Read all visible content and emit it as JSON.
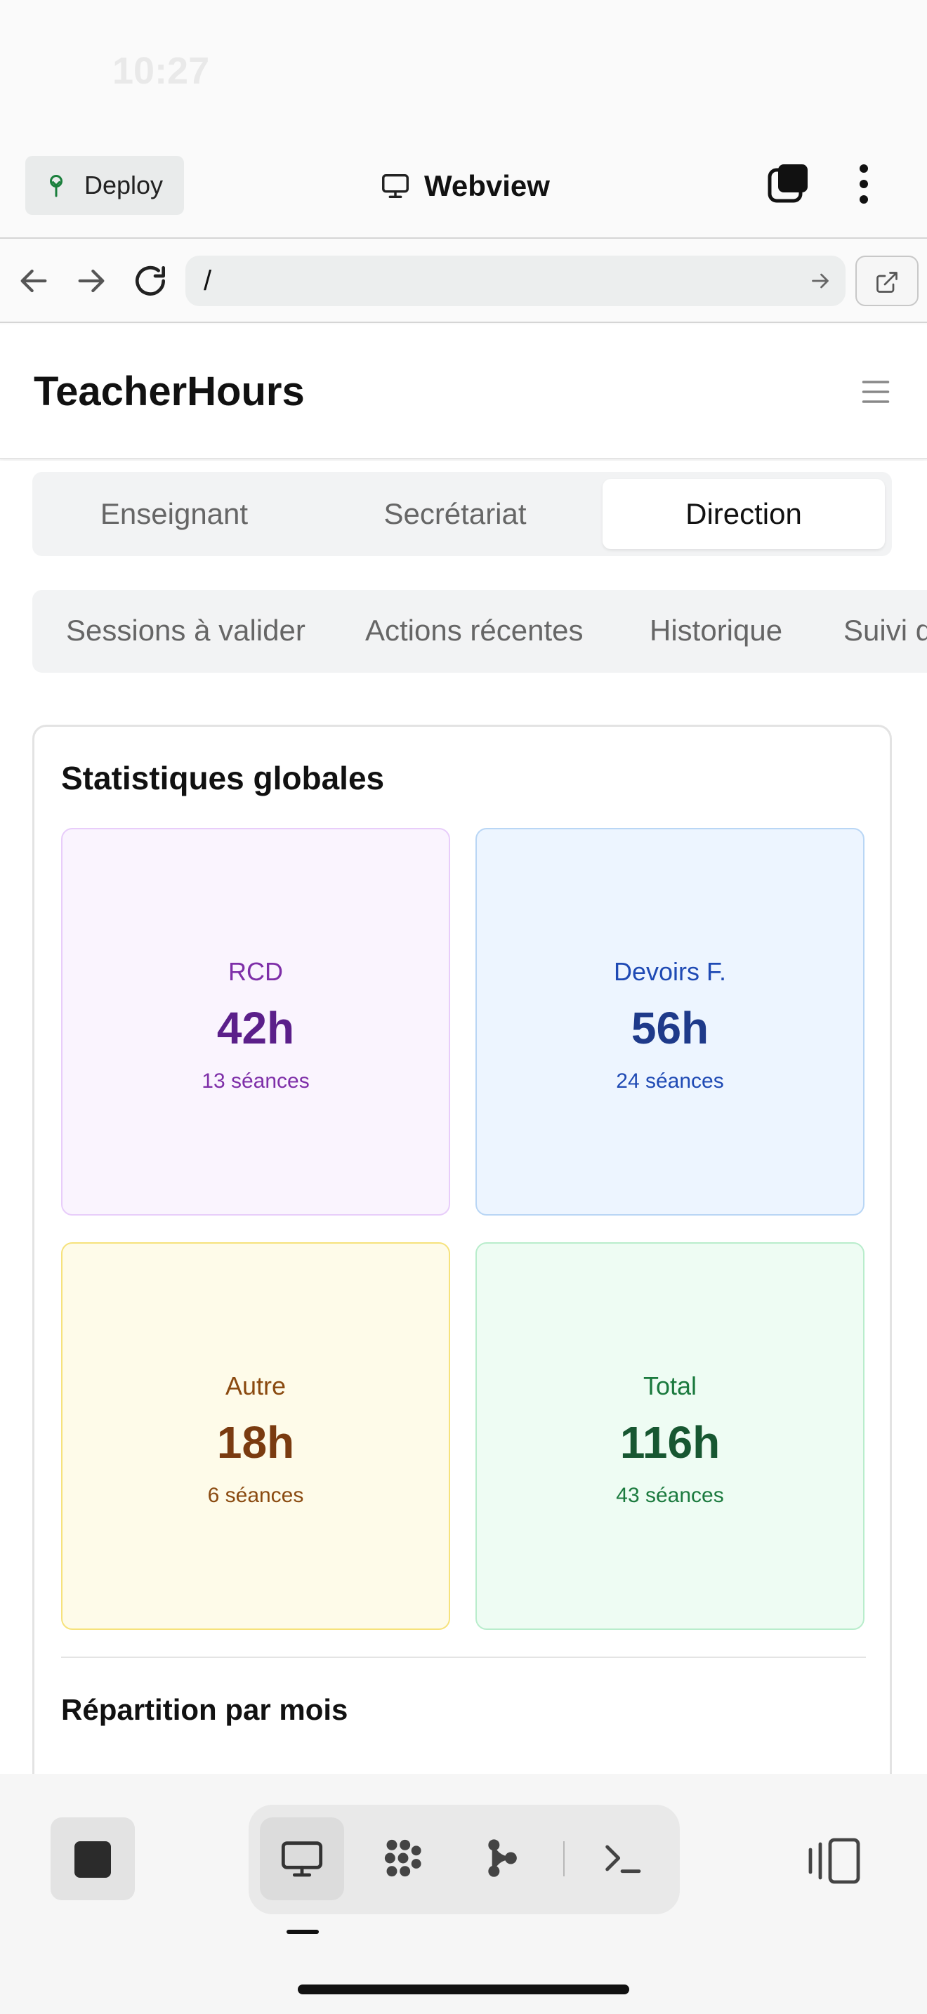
{
  "status_bar": {
    "time": "10:27"
  },
  "topbar": {
    "deploy_label": "Deploy",
    "webview_title": "Webview"
  },
  "urlbar": {
    "url": "/"
  },
  "app": {
    "title": "TeacherHours",
    "role_tabs": [
      "Enseignant",
      "Secrétariat",
      "Direction"
    ],
    "active_role": "Direction",
    "sub_tabs": [
      "Sessions à valider",
      "Actions récentes",
      "Historique",
      "Suivi d"
    ],
    "stats": {
      "title": "Statistiques globales",
      "boxes": [
        {
          "label": "RCD",
          "value": "42h",
          "count": "13 séances",
          "color": "#5b1f8a"
        },
        {
          "label": "Devoirs F.",
          "value": "56h",
          "count": "24 séances",
          "color": "#1e3a8a"
        },
        {
          "label": "Autre",
          "value": "18h",
          "count": "6 séances",
          "color": "#7a3b10"
        },
        {
          "label": "Total",
          "value": "116h",
          "count": "43 séances",
          "color": "#175731"
        }
      ],
      "monthly_title": "Répartition par mois"
    }
  },
  "icons": {
    "deploy": "deploy-tree-icon",
    "webview": "monitor-icon",
    "tabs": "tabs-icon",
    "more": "more-vertical-icon",
    "back": "arrow-left-icon",
    "forward": "arrow-right-icon",
    "reload": "reload-icon",
    "go": "arrow-right-icon",
    "open_external": "external-link-icon",
    "menu": "hamburger-icon",
    "stop": "stop-icon",
    "webview_tool": "monitor-icon",
    "grid_tool": "apps-grid-icon",
    "git_tool": "git-branch-icon",
    "shell_tool": "terminal-icon",
    "split": "split-view-icon"
  }
}
